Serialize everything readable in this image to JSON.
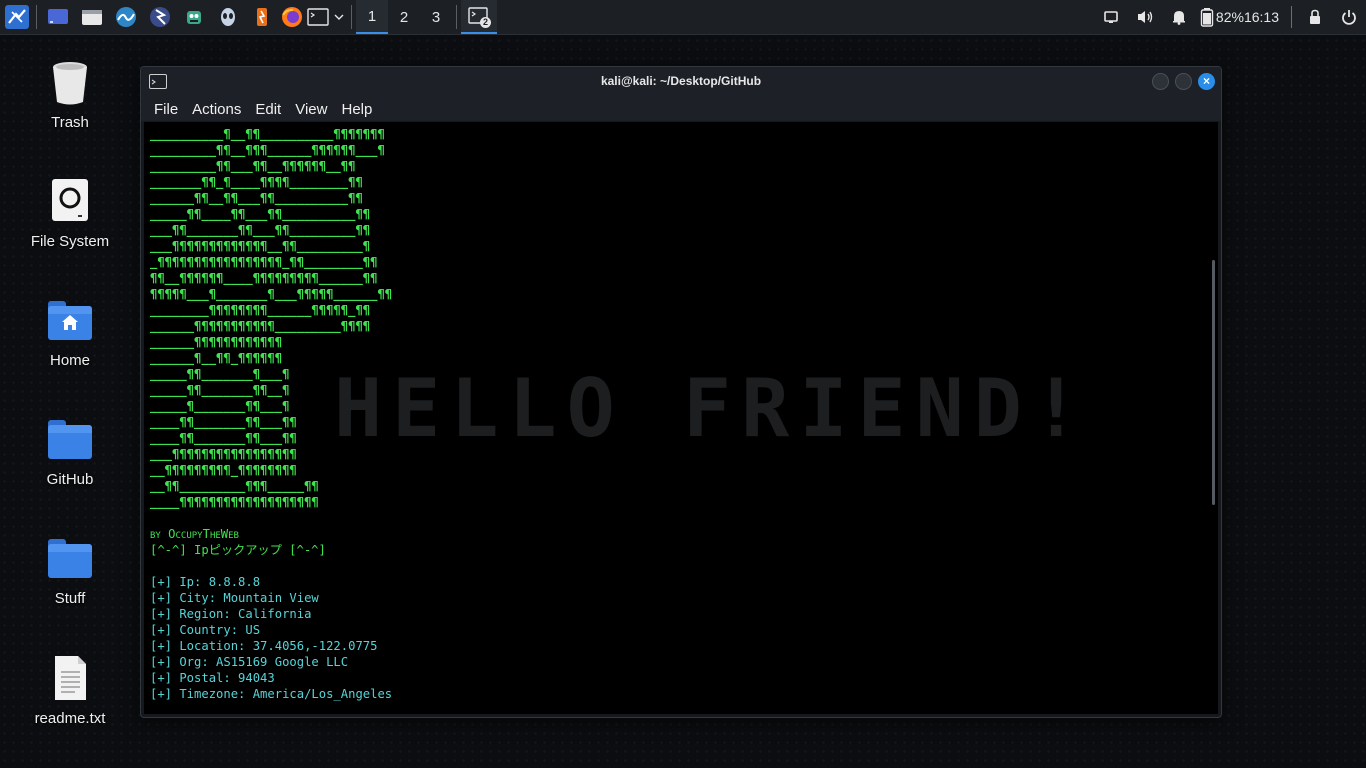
{
  "taskbar": {
    "workspaces": [
      "1",
      "2",
      "3"
    ],
    "active_workspace": "1",
    "task_badge": "2",
    "battery": "82%",
    "clock": "16:13"
  },
  "desktop": {
    "icons": [
      {
        "label": "Trash",
        "icon": "trash-icon"
      },
      {
        "label": "File System",
        "icon": "drive-icon"
      },
      {
        "label": "Home",
        "icon": "home-folder-icon"
      },
      {
        "label": "GitHub",
        "icon": "folder-icon"
      },
      {
        "label": "Stuff",
        "icon": "folder-icon"
      },
      {
        "label": "readme.txt",
        "icon": "text-file-icon"
      }
    ]
  },
  "window": {
    "title": "kali@kali: ~/Desktop/GitHub",
    "menu": [
      "File",
      "Actions",
      "Edit",
      "View",
      "Help"
    ]
  },
  "terminal": {
    "watermark": "HELLO FRIEND!",
    "art": [
      "__________¶__¶¶__________¶¶¶¶¶¶¶",
      "_________¶¶__¶¶¶______¶¶¶¶¶¶___¶",
      "_________¶¶___¶¶__¶¶¶¶¶¶__¶¶",
      "_______¶¶_¶____¶¶¶¶________¶¶",
      "______¶¶__¶¶___¶¶__________¶¶",
      "_____¶¶____¶¶___¶¶__________¶¶",
      "___¶¶_______¶¶___¶¶_________¶¶",
      "___¶¶¶¶¶¶¶¶¶¶¶¶¶__¶¶_________¶",
      "_¶¶¶¶¶¶¶¶¶¶¶¶¶¶¶¶¶_¶¶________¶¶",
      "¶¶__¶¶¶¶¶¶____¶¶¶¶¶¶¶¶¶______¶¶",
      "¶¶¶¶¶___¶_______¶___¶¶¶¶¶______¶¶",
      "________¶¶¶¶¶¶¶¶______¶¶¶¶¶_¶¶",
      "______¶¶¶¶¶¶¶¶¶¶¶_________¶¶¶¶",
      "______¶¶¶¶¶¶¶¶¶¶¶¶",
      "______¶__¶¶_¶¶¶¶¶¶",
      "_____¶¶_______¶___¶",
      "_____¶¶_______¶¶__¶",
      "_____¶_______¶¶___¶",
      "____¶¶_______¶¶___¶¶",
      "____¶¶_______¶¶___¶¶",
      "___¶¶¶¶¶¶¶¶¶¶¶¶¶¶¶¶¶",
      "__¶¶¶¶¶¶¶¶¶_¶¶¶¶¶¶¶¶",
      "__¶¶_________¶¶¶_____¶¶",
      "____¶¶¶¶¶¶¶¶¶¶¶¶¶¶¶¶¶¶¶"
    ],
    "byline": "by OccupyTheWeb",
    "banner": "[^-^] Ipピックアップ [^-^]",
    "results": [
      "[+] Ip: 8.8.8.8",
      "[+] City: Mountain View",
      "[+] Region: California",
      "[+] Country: US",
      "[+] Location: 37.4056,-122.0775",
      "[+] Org: AS15169 Google LLC",
      "[+] Postal: 94043",
      "[+] Timezone: America/Los_Angeles"
    ]
  },
  "colors": {
    "accent": "#3b8ee8",
    "art_green": "#3fe34f",
    "output_cyan": "#56d4d8"
  }
}
